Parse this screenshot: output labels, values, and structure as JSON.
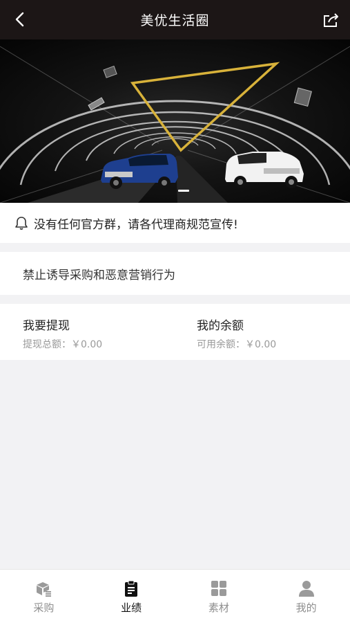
{
  "nav": {
    "title": "美优生活圈",
    "back_icon": "chevron-left-icon",
    "share_icon": "share-icon"
  },
  "banner": {
    "carousel_total": 1,
    "carousel_active": 1
  },
  "notice": {
    "icon": "bell-icon",
    "text": "没有任何官方群，请各代理商规范宣传!"
  },
  "rule": {
    "text": "禁止诱导采购和恶意营销行为"
  },
  "finance": {
    "withdraw_label": "我要提现",
    "withdraw_total": "提现总额：￥0.00",
    "balance_label": "我的余额",
    "balance_available": "可用余额：￥0.00"
  },
  "tabbar": {
    "items": [
      {
        "label": "采购",
        "icon": "cube-icon",
        "active": false
      },
      {
        "label": "业绩",
        "icon": "clipboard-icon",
        "active": true
      },
      {
        "label": "素材",
        "icon": "grid-icon",
        "active": false
      },
      {
        "label": "我的",
        "icon": "user-icon",
        "active": false
      }
    ]
  },
  "colors": {
    "nav_bg": "#1c1616",
    "page_bg": "#f2f2f4",
    "accent_gold": "#d8b23a",
    "tab_active": "#111111",
    "tab_inactive": "#8e8e8e"
  }
}
